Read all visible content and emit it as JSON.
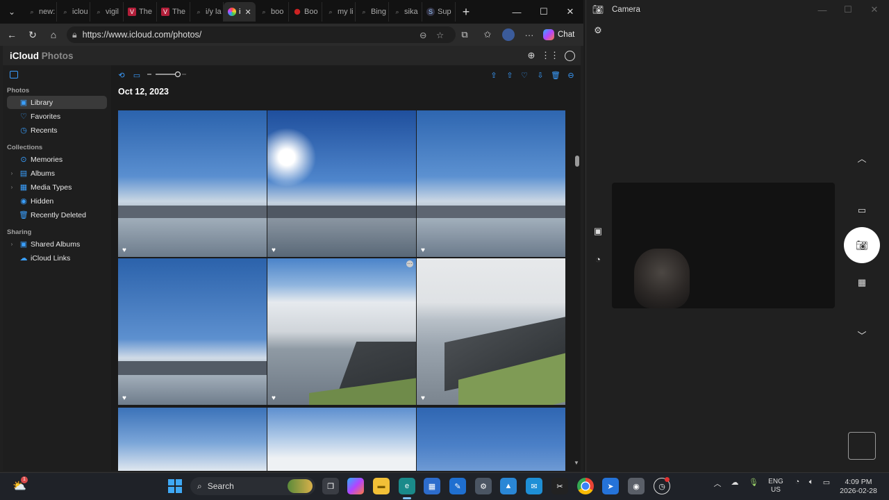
{
  "browser": {
    "tabs": [
      {
        "label": "new:",
        "icon": "search-icon"
      },
      {
        "label": "iclou",
        "icon": "search-icon"
      },
      {
        "label": "vigil",
        "icon": "search-icon"
      },
      {
        "label": "The",
        "icon": "verge-icon"
      },
      {
        "label": "The",
        "icon": "verge-icon"
      },
      {
        "label": "i/y la",
        "icon": "search-icon"
      },
      {
        "label": "i",
        "icon": "icloud-photos-icon",
        "active": true
      },
      {
        "label": "boo",
        "icon": "search-icon"
      },
      {
        "label": "Boo",
        "icon": "red-dot-icon"
      },
      {
        "label": "my li",
        "icon": "search-icon"
      },
      {
        "label": "Bing",
        "icon": "search-icon"
      },
      {
        "label": "sika",
        "icon": "search-icon"
      },
      {
        "label": "Sup",
        "icon": "s-icon"
      }
    ],
    "url": "https://www.icloud.com/photos/",
    "chat_label": "Chat"
  },
  "icloud": {
    "brand": "iCloud",
    "brand_sub": "Photos",
    "sidebar": {
      "photos_heading": "Photos",
      "photos_items": [
        "Library",
        "Favorites",
        "Recents"
      ],
      "collections_heading": "Collections",
      "collections_items": [
        "Memories",
        "Albums",
        "Media Types",
        "Hidden",
        "Recently Deleted"
      ],
      "sharing_heading": "Sharing",
      "sharing_items": [
        "Shared Albums",
        "iCloud Links"
      ]
    },
    "date_title": "Oct 12, 2023"
  },
  "camera": {
    "title": "Camera"
  },
  "taskbar": {
    "search_label": "Search",
    "lang_top": "ENG",
    "lang_bottom": "US",
    "time": "4:09 PM",
    "date": "2026-02-28",
    "notif_badge": "1"
  },
  "colors": {
    "accent": "#3a9dff",
    "icloud_bg": "#1b1b1b",
    "taskbar_bg": "#1f2228"
  }
}
